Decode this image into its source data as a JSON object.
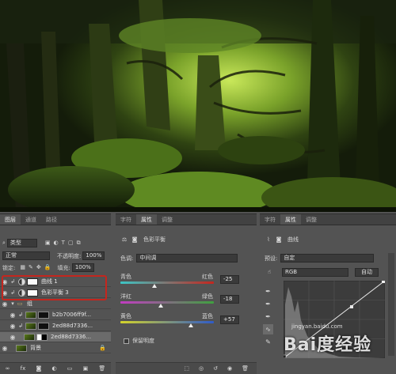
{
  "layers_panel": {
    "tabs": [
      "图层",
      "通道",
      "路径"
    ],
    "filter_label": "类型",
    "blend_mode": "正常",
    "opacity_label": "不透明度:",
    "opacity_value": "100%",
    "lock_label": "锁定:",
    "fill_label": "填充:",
    "fill_value": "100%",
    "layers": [
      {
        "name": "曲线 1"
      },
      {
        "name": "色彩平衡 3"
      },
      {
        "name": "组"
      },
      {
        "name": "b2b7006ff9f..."
      },
      {
        "name": "2ed88d7336..."
      },
      {
        "name": "2ed88d7336..."
      },
      {
        "name": "背景"
      }
    ],
    "bottom_icons": [
      "link-icon",
      "fx-icon",
      "mask-icon",
      "adjustment-icon",
      "folder-icon",
      "new-layer-icon",
      "trash-icon"
    ]
  },
  "properties_panel": {
    "tabs": [
      "字符",
      "属性",
      "调整"
    ],
    "title": "色彩平衡",
    "tone_label": "色调:",
    "tone_value": "中间调",
    "sliders": [
      {
        "left": "青色",
        "right": "红色",
        "value": "-25",
        "color": "#c4261e"
      },
      {
        "left": "洋红",
        "right": "绿色",
        "value": "-18",
        "color": "#3fa13f"
      },
      {
        "left": "黄色",
        "right": "蓝色",
        "value": "+57",
        "color": "#2f5bc9"
      }
    ],
    "preserve_label": "保留明度"
  },
  "curves_panel": {
    "tabs": [
      "字符",
      "属性",
      "调整"
    ],
    "title": "曲线",
    "preset_label": "预设:",
    "preset_value": "自定",
    "channel_value": "RGB",
    "auto_button": "自动"
  },
  "watermark": {
    "brand": "Bai度经验",
    "url": "jingyan.baidu.com"
  }
}
